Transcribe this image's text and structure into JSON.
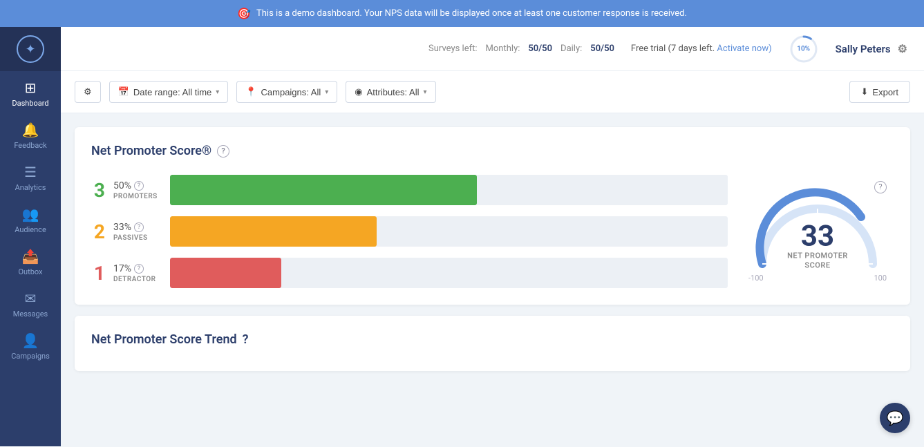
{
  "banner": {
    "icon": "🎯",
    "text": "This is a demo dashboard. Your NPS data will be displayed once at least one customer response is received."
  },
  "sidebar": {
    "logo_icon": "✦",
    "items": [
      {
        "id": "dashboard",
        "icon": "⊞",
        "label": "Dashboard",
        "active": true
      },
      {
        "id": "feedback",
        "icon": "🔔",
        "label": "Feedback",
        "active": false
      },
      {
        "id": "analytics",
        "icon": "≡",
        "label": "Analytics",
        "active": false
      },
      {
        "id": "audience",
        "icon": "👥",
        "label": "Audience",
        "active": false
      },
      {
        "id": "outbox",
        "icon": "📤",
        "label": "Outbox",
        "active": false
      },
      {
        "id": "messages",
        "icon": "✉",
        "label": "Messages",
        "active": false
      },
      {
        "id": "campaigns",
        "icon": "👤",
        "label": "Campaigns",
        "active": false
      }
    ]
  },
  "header": {
    "surveys_label": "Surveys left:",
    "monthly_label": "Monthly:",
    "monthly_value": "50/50",
    "daily_label": "Daily:",
    "daily_value": "50/50",
    "trial_label": "Free trial",
    "trial_days": "(7 days left.",
    "activate_label": "Activate now)",
    "progress_pct": "10%",
    "user_name": "Sally Peters"
  },
  "filters": {
    "tune_icon": "⚙",
    "date_range_icon": "📅",
    "date_range_label": "Date range: All time",
    "campaigns_icon": "📍",
    "campaigns_label": "Campaigns: All",
    "attributes_icon": "◉",
    "attributes_label": "Attributes: All",
    "export_icon": "⬇",
    "export_label": "Export"
  },
  "nps_card": {
    "title": "Net Promoter Score®",
    "bars": [
      {
        "number": "3",
        "pct": "50%",
        "label": "PROMOTERS",
        "type": "promoter",
        "fill": 55
      },
      {
        "number": "2",
        "pct": "33%",
        "label": "PASSIVES",
        "type": "passive",
        "fill": 37
      },
      {
        "number": "1",
        "pct": "17%",
        "label": "DETRACTOR",
        "type": "detractor",
        "fill": 20
      }
    ],
    "gauge": {
      "score": "33",
      "subtitle": "NET PROMOTER\nSCORE",
      "min": "-100",
      "max": "100",
      "pct": 67
    }
  },
  "trend_card": {
    "title": "Net Promoter Score Trend"
  },
  "chat": {
    "icon": "💬"
  }
}
